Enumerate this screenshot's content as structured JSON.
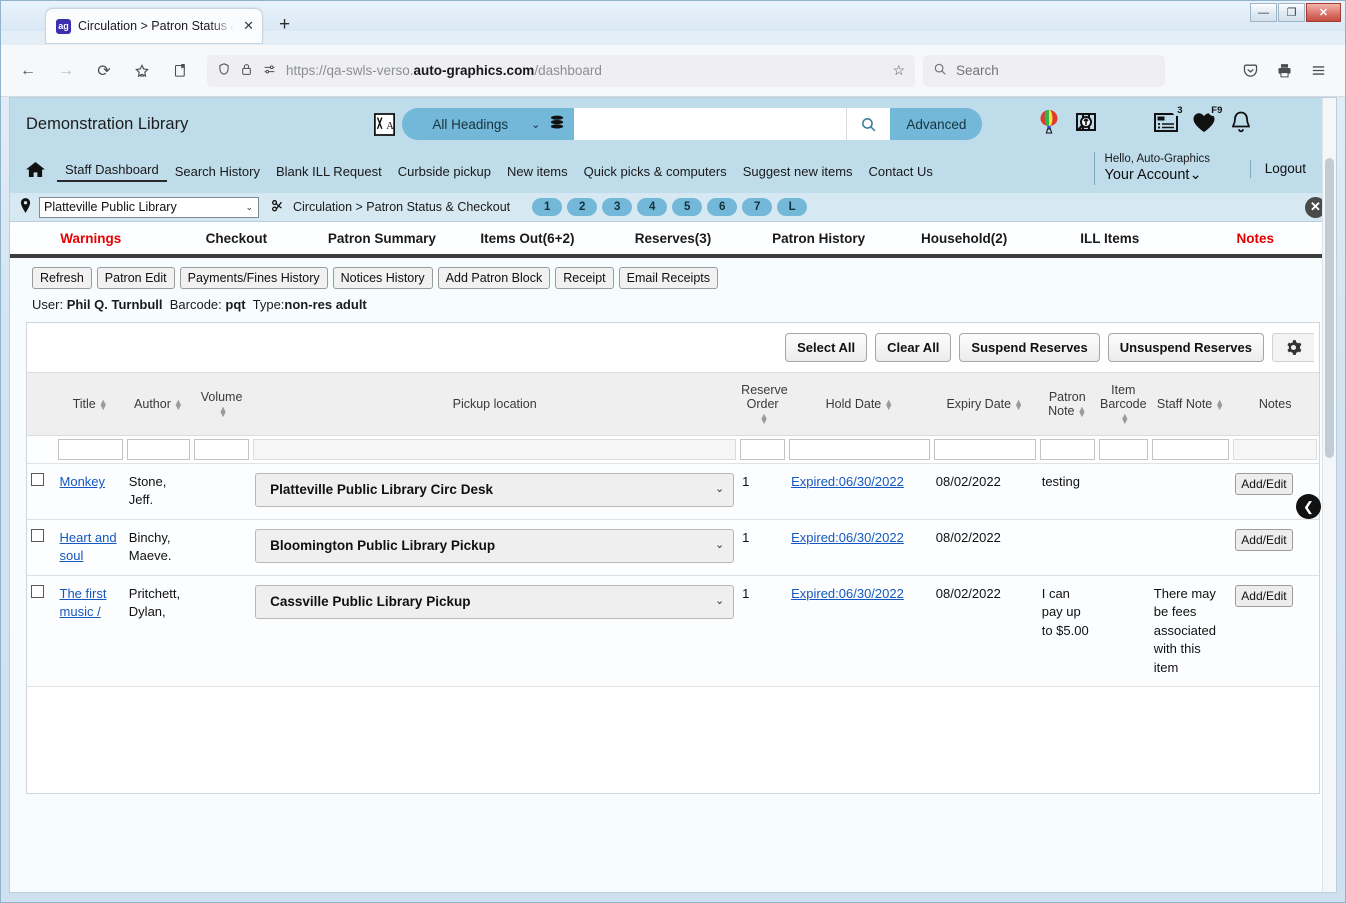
{
  "window": {
    "minimize": "—",
    "maximize": "❐",
    "close": "✕"
  },
  "browser": {
    "tab": {
      "favicon_label": "ag",
      "title": "Circulation > Patron Status & Ch",
      "close": "✕"
    },
    "new_tab": "+",
    "back": "←",
    "forward": "→",
    "reload": "⟳",
    "url_prefix": "https://qa-swls-verso.",
    "url_domain": "auto-graphics.com",
    "url_path": "/dashboard",
    "search_placeholder": "Search",
    "star": "☆"
  },
  "app": {
    "library_name": "Demonstration Library",
    "search": {
      "scope_label": "All Headings",
      "value": "",
      "advanced_label": "Advanced"
    },
    "header_icons": [
      {
        "name": "balloon-icon",
        "glyph": "🎈",
        "badge": ""
      },
      {
        "name": "catalog-search-icon",
        "glyph": "🔍",
        "badge": ""
      },
      {
        "name": "lists-icon",
        "glyph": "📋",
        "badge": "3"
      },
      {
        "name": "favorites-icon",
        "glyph": "♥",
        "badge": "F9"
      },
      {
        "name": "notifications-icon",
        "glyph": "🔔",
        "badge": ""
      }
    ],
    "nav_links": [
      "Staff Dashboard",
      "Search History",
      "Blank ILL Request",
      "Curbside pickup",
      "New items",
      "Quick picks & computers",
      "Suggest new items",
      "Contact Us"
    ],
    "account": {
      "hello": "Hello, Auto-Graphics",
      "link": "Your Account",
      "logout": "Logout"
    }
  },
  "crumbbar": {
    "library": "Platteville Public Library",
    "breadcrumb": "Circulation > Patron Status & Checkout",
    "pills": [
      "1",
      "2",
      "3",
      "4",
      "5",
      "6",
      "7",
      "L"
    ],
    "close": "✕"
  },
  "module_tabs": [
    {
      "label": "Warnings",
      "alert": true
    },
    {
      "label": "Checkout",
      "alert": false
    },
    {
      "label": "Patron Summary",
      "alert": false
    },
    {
      "label": "Items Out(6+2)",
      "alert": false
    },
    {
      "label": "Reserves(3)",
      "alert": false
    },
    {
      "label": "Patron History",
      "alert": false
    },
    {
      "label": "Household(2)",
      "alert": false
    },
    {
      "label": "ILL Items",
      "alert": false
    },
    {
      "label": "Notes",
      "alert": true
    }
  ],
  "toolbar": {
    "buttons": [
      "Refresh",
      "Patron Edit",
      "Payments/Fines History",
      "Notices History",
      "Add Patron Block",
      "Receipt",
      "Email Receipts"
    ],
    "user_label": "User:",
    "user_name": "Phil Q. Turnbull",
    "barcode_label": "Barcode:",
    "barcode_value": "pqt",
    "type_label": "Type:",
    "type_value": "non-res adult"
  },
  "panel": {
    "actions": [
      "Select All",
      "Clear All",
      "Suspend Reserves",
      "Unsuspend Reserves"
    ],
    "gear": "⚙",
    "collapse": "❮"
  },
  "table": {
    "headers": [
      {
        "label": "",
        "sortable": false
      },
      {
        "label": "Title",
        "sortable": true
      },
      {
        "label": "Author",
        "sortable": true
      },
      {
        "label": "Volume",
        "sortable": true
      },
      {
        "label": "Pickup location",
        "sortable": false
      },
      {
        "label": "Reserve Order",
        "sortable": true
      },
      {
        "label": "Hold Date",
        "sortable": true
      },
      {
        "label": "Expiry Date",
        "sortable": true
      },
      {
        "label": "Patron Note",
        "sortable": true
      },
      {
        "label": "Item Barcode",
        "sortable": true
      },
      {
        "label": "Staff Note",
        "sortable": true
      },
      {
        "label": "Notes",
        "sortable": false
      }
    ],
    "filters": [
      "",
      "",
      "",
      "",
      "",
      "",
      "",
      "",
      "",
      "",
      "",
      ""
    ],
    "rows": [
      {
        "checked": false,
        "title": "Monkey",
        "author": "Stone, Jeff.",
        "volume": "",
        "pickup_location": "Platteville Public Library Circ Desk",
        "reserve_order": "1",
        "hold_date": "Expired:06/30/2022",
        "expiry_date": "08/02/2022",
        "patron_note": "testing",
        "item_barcode": "",
        "staff_note": "",
        "notes_button": "Add/Edit"
      },
      {
        "checked": false,
        "title": "Heart and soul",
        "author": "Binchy, Maeve.",
        "volume": "",
        "pickup_location": "Bloomington Public Library Pickup",
        "reserve_order": "1",
        "hold_date": "Expired:06/30/2022",
        "expiry_date": "08/02/2022",
        "patron_note": "",
        "item_barcode": "",
        "staff_note": "",
        "notes_button": "Add/Edit"
      },
      {
        "checked": false,
        "title": "The first music /",
        "author": "Pritchett, Dylan,",
        "volume": "",
        "pickup_location": "Cassville Public Library Pickup",
        "reserve_order": "1",
        "hold_date": "Expired:06/30/2022",
        "expiry_date": "08/02/2022",
        "patron_note": "I can pay up to $5.00",
        "item_barcode": "",
        "staff_note": "There may be fees associated with this item",
        "notes_button": "Add/Edit"
      }
    ]
  },
  "colors": {
    "app_header": "#bfdcea",
    "accent": "#73b8d8",
    "alert": "#e60000",
    "link": "#1558bf"
  }
}
